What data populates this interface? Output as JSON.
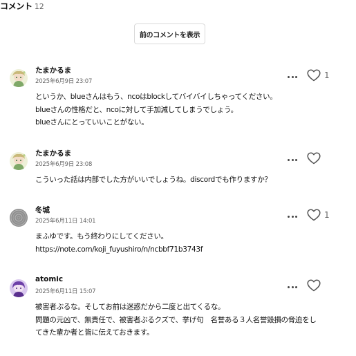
{
  "header": {
    "title": "コメント",
    "count": "12"
  },
  "prev_button_label": "前のコメントを表示",
  "comments": [
    {
      "author": "たまかるま",
      "timestamp": "2025年6月9日 23:07",
      "lines": [
        "というか、blueさんはもう、ncoはblockしてバイバイしちゃってください。",
        "blueさんの性格だと、ncoに対して手加減してしまうでしょう。",
        "blueさんにとっていいことがない。"
      ],
      "likes": "1",
      "avatar_icon": "anime-character-avatar-icon"
    },
    {
      "author": "たまかるま",
      "timestamp": "2025年6月9日 23:08",
      "lines": [
        "こういった話は内部でした方がいいでしょうね。discordでも作りますか？"
      ],
      "likes": "",
      "avatar_icon": "anime-character-avatar-icon"
    },
    {
      "author": "冬城",
      "timestamp": "2025年6月11日 14:01",
      "lines": [
        "まふゆです。もう終わりにしてください。",
        "https://note.com/koji_fuyushiro/n/ncbbf71b3743f"
      ],
      "likes": "1",
      "avatar_icon": "gray-fingerprint-avatar-icon"
    },
    {
      "author": "atomic",
      "timestamp": "2025年6月11日 15:07",
      "lines": [
        "被害者ぶるな。そしてお前は迷惑だから二度と出てくるな。",
        "問題の元凶で、無責任で、被害者ぶるクズで、挙げ句　名誉ある３人名誉毀損の脅迫をし",
        "てきた輩か者と皆に伝えておきます。"
      ],
      "likes": "",
      "avatar_icon": "purple-character-avatar-icon"
    }
  ],
  "icons": {
    "more": "more-options-icon",
    "like": "heart-icon"
  },
  "colors": {
    "text": "#111111",
    "meta": "#666666",
    "button_border": "#d9d9d9"
  }
}
